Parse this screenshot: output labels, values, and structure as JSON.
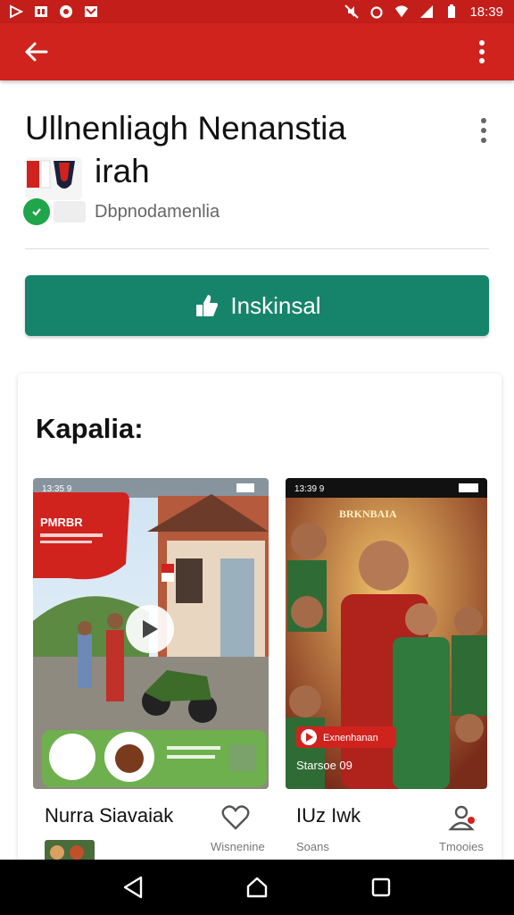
{
  "status_bar": {
    "time": "18:39",
    "left_icons": [
      "play-store-icon",
      "image-icon",
      "notification-icon",
      "mail-icon"
    ],
    "right_icons": [
      "mute-icon",
      "alarm-icon",
      "wifi-icon",
      "signal-icon",
      "battery-icon"
    ]
  },
  "app_bar": {
    "bg_color": "#d0231e",
    "back_icon": "arrow-left-icon",
    "more_icon": "more-vertical-icon"
  },
  "app": {
    "title_line1": "Ullnenliagh Nenanstia",
    "title_line2": "irah",
    "developer": "Dbpnodamenlia"
  },
  "install": {
    "label": "Inskinsal",
    "color": "#16846a"
  },
  "screenshots": {
    "heading": "Kapalia:",
    "items": [
      {
        "status_time": "13:35 9",
        "banner_text": "PMRBR",
        "name": "Nurra Siavaiak",
        "action_icon": "heart-icon",
        "sub_right": "Wisnenine"
      },
      {
        "status_time": "13:39 9",
        "banner_text": "BRKNBAIA",
        "overlay_label": "Exnenhanan",
        "overlay_sub": "Starsoe 09",
        "name": "IUz Iwk",
        "action_icon": "person-icon",
        "sub_left": "Soans",
        "sub_right": "Tmooies"
      }
    ]
  },
  "nav_bar": {
    "buttons": [
      "back-triangle-icon",
      "home-icon",
      "recents-icon"
    ]
  }
}
